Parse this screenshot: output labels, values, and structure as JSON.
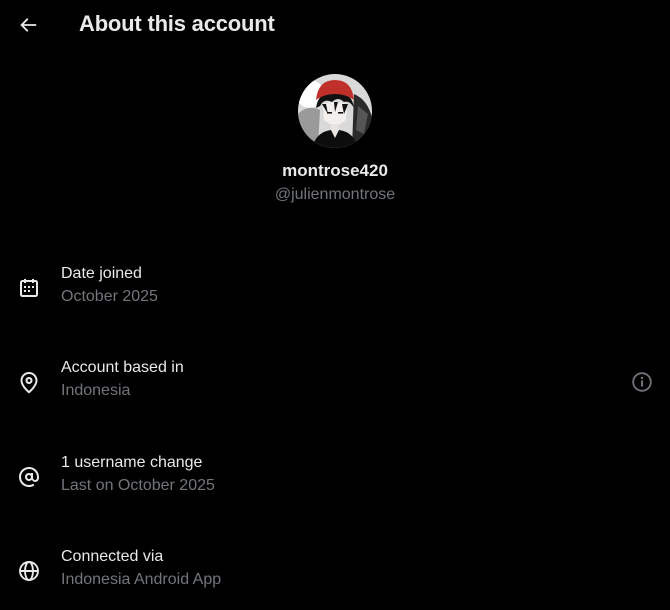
{
  "header": {
    "title": "About this account",
    "back_icon": "arrow-left-icon"
  },
  "profile": {
    "display_name": "montrose420",
    "handle": "@julienmontrose",
    "avatar_accent": "#c0302b"
  },
  "details": [
    {
      "icon": "calendar-icon",
      "label": "Date joined",
      "value": "October 2025"
    },
    {
      "icon": "location-pin-icon",
      "label": "Account based in",
      "value": "Indonesia",
      "info_icon": "info-icon"
    },
    {
      "icon": "at-sign-icon",
      "label": "1 username change",
      "value": "Last on October 2025"
    },
    {
      "icon": "globe-icon",
      "label": "Connected via",
      "value": "Indonesia Android App"
    }
  ],
  "colors": {
    "background": "#000000",
    "primary_text": "#e7e9ea",
    "secondary_text": "#71767b"
  }
}
